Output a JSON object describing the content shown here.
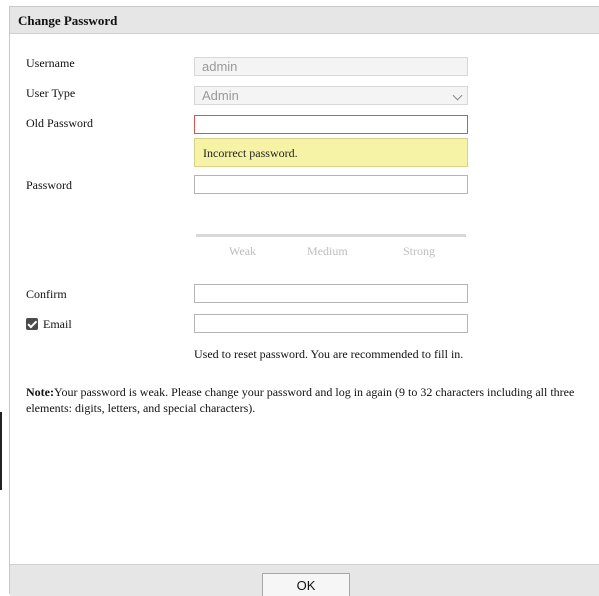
{
  "dialog": {
    "title": "Change Password"
  },
  "form": {
    "username": {
      "label": "Username",
      "value": "admin"
    },
    "user_type": {
      "label": "User Type",
      "value": "Admin"
    },
    "old_password": {
      "label": "Old Password",
      "value": "",
      "error": "Incorrect password."
    },
    "password": {
      "label": "Password",
      "value": ""
    },
    "strength": {
      "weak": "Weak",
      "medium": "Medium",
      "strong": "Strong",
      "level": 0
    },
    "confirm": {
      "label": "Confirm",
      "value": ""
    },
    "email": {
      "label": "Email",
      "checked": true,
      "value": "",
      "hint": "Used to reset password. You are recommended to fill in."
    }
  },
  "note": {
    "prefix": "Note:",
    "text": "Your password is weak. Please change your password and log in again (9 to 32 characters including all three elements: digits, letters, and special characters)."
  },
  "footer": {
    "ok_label": "OK"
  },
  "colors": {
    "header_bg": "#e6e6e6",
    "error_border": "#d9534f",
    "tooltip_bg": "#f7f3a6",
    "strength_inactive": "#bdbdbd"
  }
}
